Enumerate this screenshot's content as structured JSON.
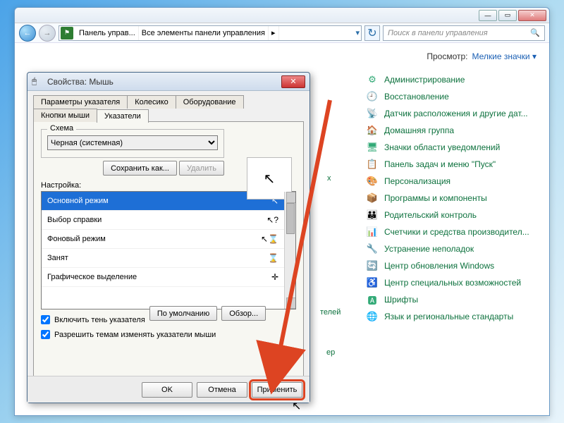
{
  "explorer": {
    "breadcrumb": {
      "root": "Панель управ...",
      "all": "Все элементы панели управления"
    },
    "search_placeholder": "Поиск в панели управления",
    "view_label": "Просмотр:",
    "view_value": "Мелкие значки"
  },
  "cp_items": [
    {
      "icon": "⚙",
      "label": "Администрирование"
    },
    {
      "icon": "🕘",
      "label": "Восстановление"
    },
    {
      "icon": "📡",
      "label": "Датчик расположения и другие дат..."
    },
    {
      "icon": "🏠",
      "label": "Домашняя группа"
    },
    {
      "icon": "🖥",
      "label": "Значки области уведомлений"
    },
    {
      "icon": "📋",
      "label": "Панель задач и меню \"Пуск\""
    },
    {
      "icon": "🎨",
      "label": "Персонализация"
    },
    {
      "icon": "📦",
      "label": "Программы и компоненты"
    },
    {
      "icon": "👪",
      "label": "Родительский контроль"
    },
    {
      "icon": "📊",
      "label": "Счетчики и средства производител..."
    },
    {
      "icon": "🔧",
      "label": "Устранение неполадок"
    },
    {
      "icon": "🔄",
      "label": "Центр обновления Windows"
    },
    {
      "icon": "♿",
      "label": "Центр специальных возможностей"
    },
    {
      "icon": "🅰",
      "label": "Шрифты"
    },
    {
      "icon": "🌐",
      "label": "Язык и региональные стандарты"
    }
  ],
  "stray": {
    "x": "х",
    "t1": "телей",
    "t2": "ер"
  },
  "dialog": {
    "title": "Свойства: Мышь",
    "tabs_row1": [
      "Параметры указателя",
      "Колесико",
      "Оборудование"
    ],
    "tabs_row2": [
      "Кнопки мыши",
      "Указатели"
    ],
    "scheme_label": "Схема",
    "scheme_value": "Черная (системная)",
    "save_as": "Сохранить как...",
    "delete": "Удалить",
    "custom_label": "Настройка:",
    "list": [
      {
        "label": "Основной режим",
        "glyph": "↖"
      },
      {
        "label": "Выбор справки",
        "glyph": "↖?"
      },
      {
        "label": "Фоновый режим",
        "glyph": "↖⌛"
      },
      {
        "label": "Занят",
        "glyph": "⌛"
      },
      {
        "label": "Графическое выделение",
        "glyph": "✛"
      }
    ],
    "chk_shadow": "Включить тень указателя",
    "chk_themes": "Разрешить темам изменять указатели мыши",
    "defaults": "По умолчанию",
    "browse": "Обзор...",
    "ok": "OK",
    "cancel": "Отмена",
    "apply": "Применить"
  }
}
